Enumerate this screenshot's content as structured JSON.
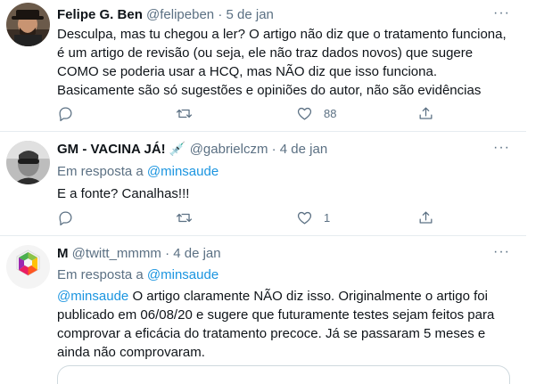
{
  "tweets": [
    {
      "name": "Felipe G. Ben",
      "handle": "@felipeben",
      "date": "5 de jan",
      "text_lines": [
        "Desculpa, mas tu chegou a ler? O artigo não diz que o tratamento funciona,",
        "é um artigo de revisão (ou seja, ele não traz dados novos) que sugere",
        "COMO se poderia usar a HCQ, mas NÃO diz que isso funciona.",
        "Basicamente são só sugestões e opiniões do autor, não são evidências"
      ],
      "like_count": "88"
    },
    {
      "name": "GM - VACINA JÁ! 💉",
      "handle": "@gabrielczm",
      "date": "4 de jan",
      "reply_prefix": "Em resposta a",
      "reply_to": "@minsaude",
      "text_lines": [
        "E a fonte? Canalhas!!!"
      ],
      "like_count": "1"
    },
    {
      "name": "M",
      "handle": "@twitt_mmmm",
      "date": "4 de jan",
      "reply_prefix": "Em resposta a",
      "reply_to": "@minsaude",
      "mention": "@minsaude",
      "text_first": " O artigo claramente NÃO diz isso. Originalmente o artigo foi",
      "text_lines": [
        "publicado em 06/08/20 e sugere que futuramente testes sejam feitos para",
        "comprovar a eficácia do tratamento precoce. Já se passaram 5 meses e",
        "ainda não comprovaram."
      ]
    }
  ],
  "separator": "·",
  "more_glyph": "···",
  "icons": {
    "reply": "reply-icon",
    "retweet": "retweet-icon",
    "like": "heart-icon",
    "share": "share-icon",
    "more": "more-icon"
  },
  "colors": {
    "link": "#1b95e0",
    "muted": "#5b7083",
    "text": "#0f1419"
  }
}
